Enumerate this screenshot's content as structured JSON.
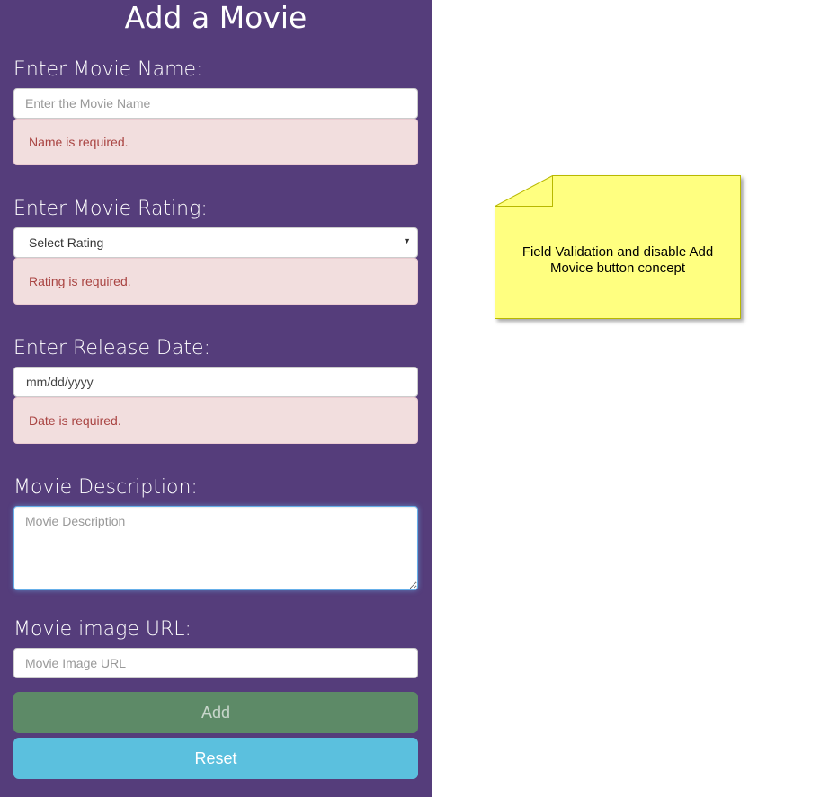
{
  "form": {
    "title": "Add a Movie",
    "name_label": "Enter Movie Name:",
    "name_placeholder": "Enter the Movie Name",
    "name_error": "Name is required.",
    "rating_label": "Enter Movie Rating:",
    "rating_selected": "Select Rating",
    "rating_error": "Rating is required.",
    "date_label": "Enter Release Date:",
    "date_value": "mm/dd/yyyy",
    "date_error": "Date is required.",
    "description_label": "Movie Description:",
    "description_placeholder": "Movie Description",
    "image_label": "Movie image URL:",
    "image_placeholder": "Movie Image URL",
    "add_label": "Add",
    "reset_label": "Reset"
  },
  "note": {
    "text": "Field Validation and disable Add Movice button concept"
  },
  "colors": {
    "panel": "#553d7b",
    "alert_bg": "#f2dede",
    "alert_text": "#a94442",
    "add_button": "#5d8a67",
    "reset_button": "#5bc0de",
    "note_fill": "#ffff80"
  },
  "icons": {
    "select_arrow": "caret-down-icon"
  }
}
